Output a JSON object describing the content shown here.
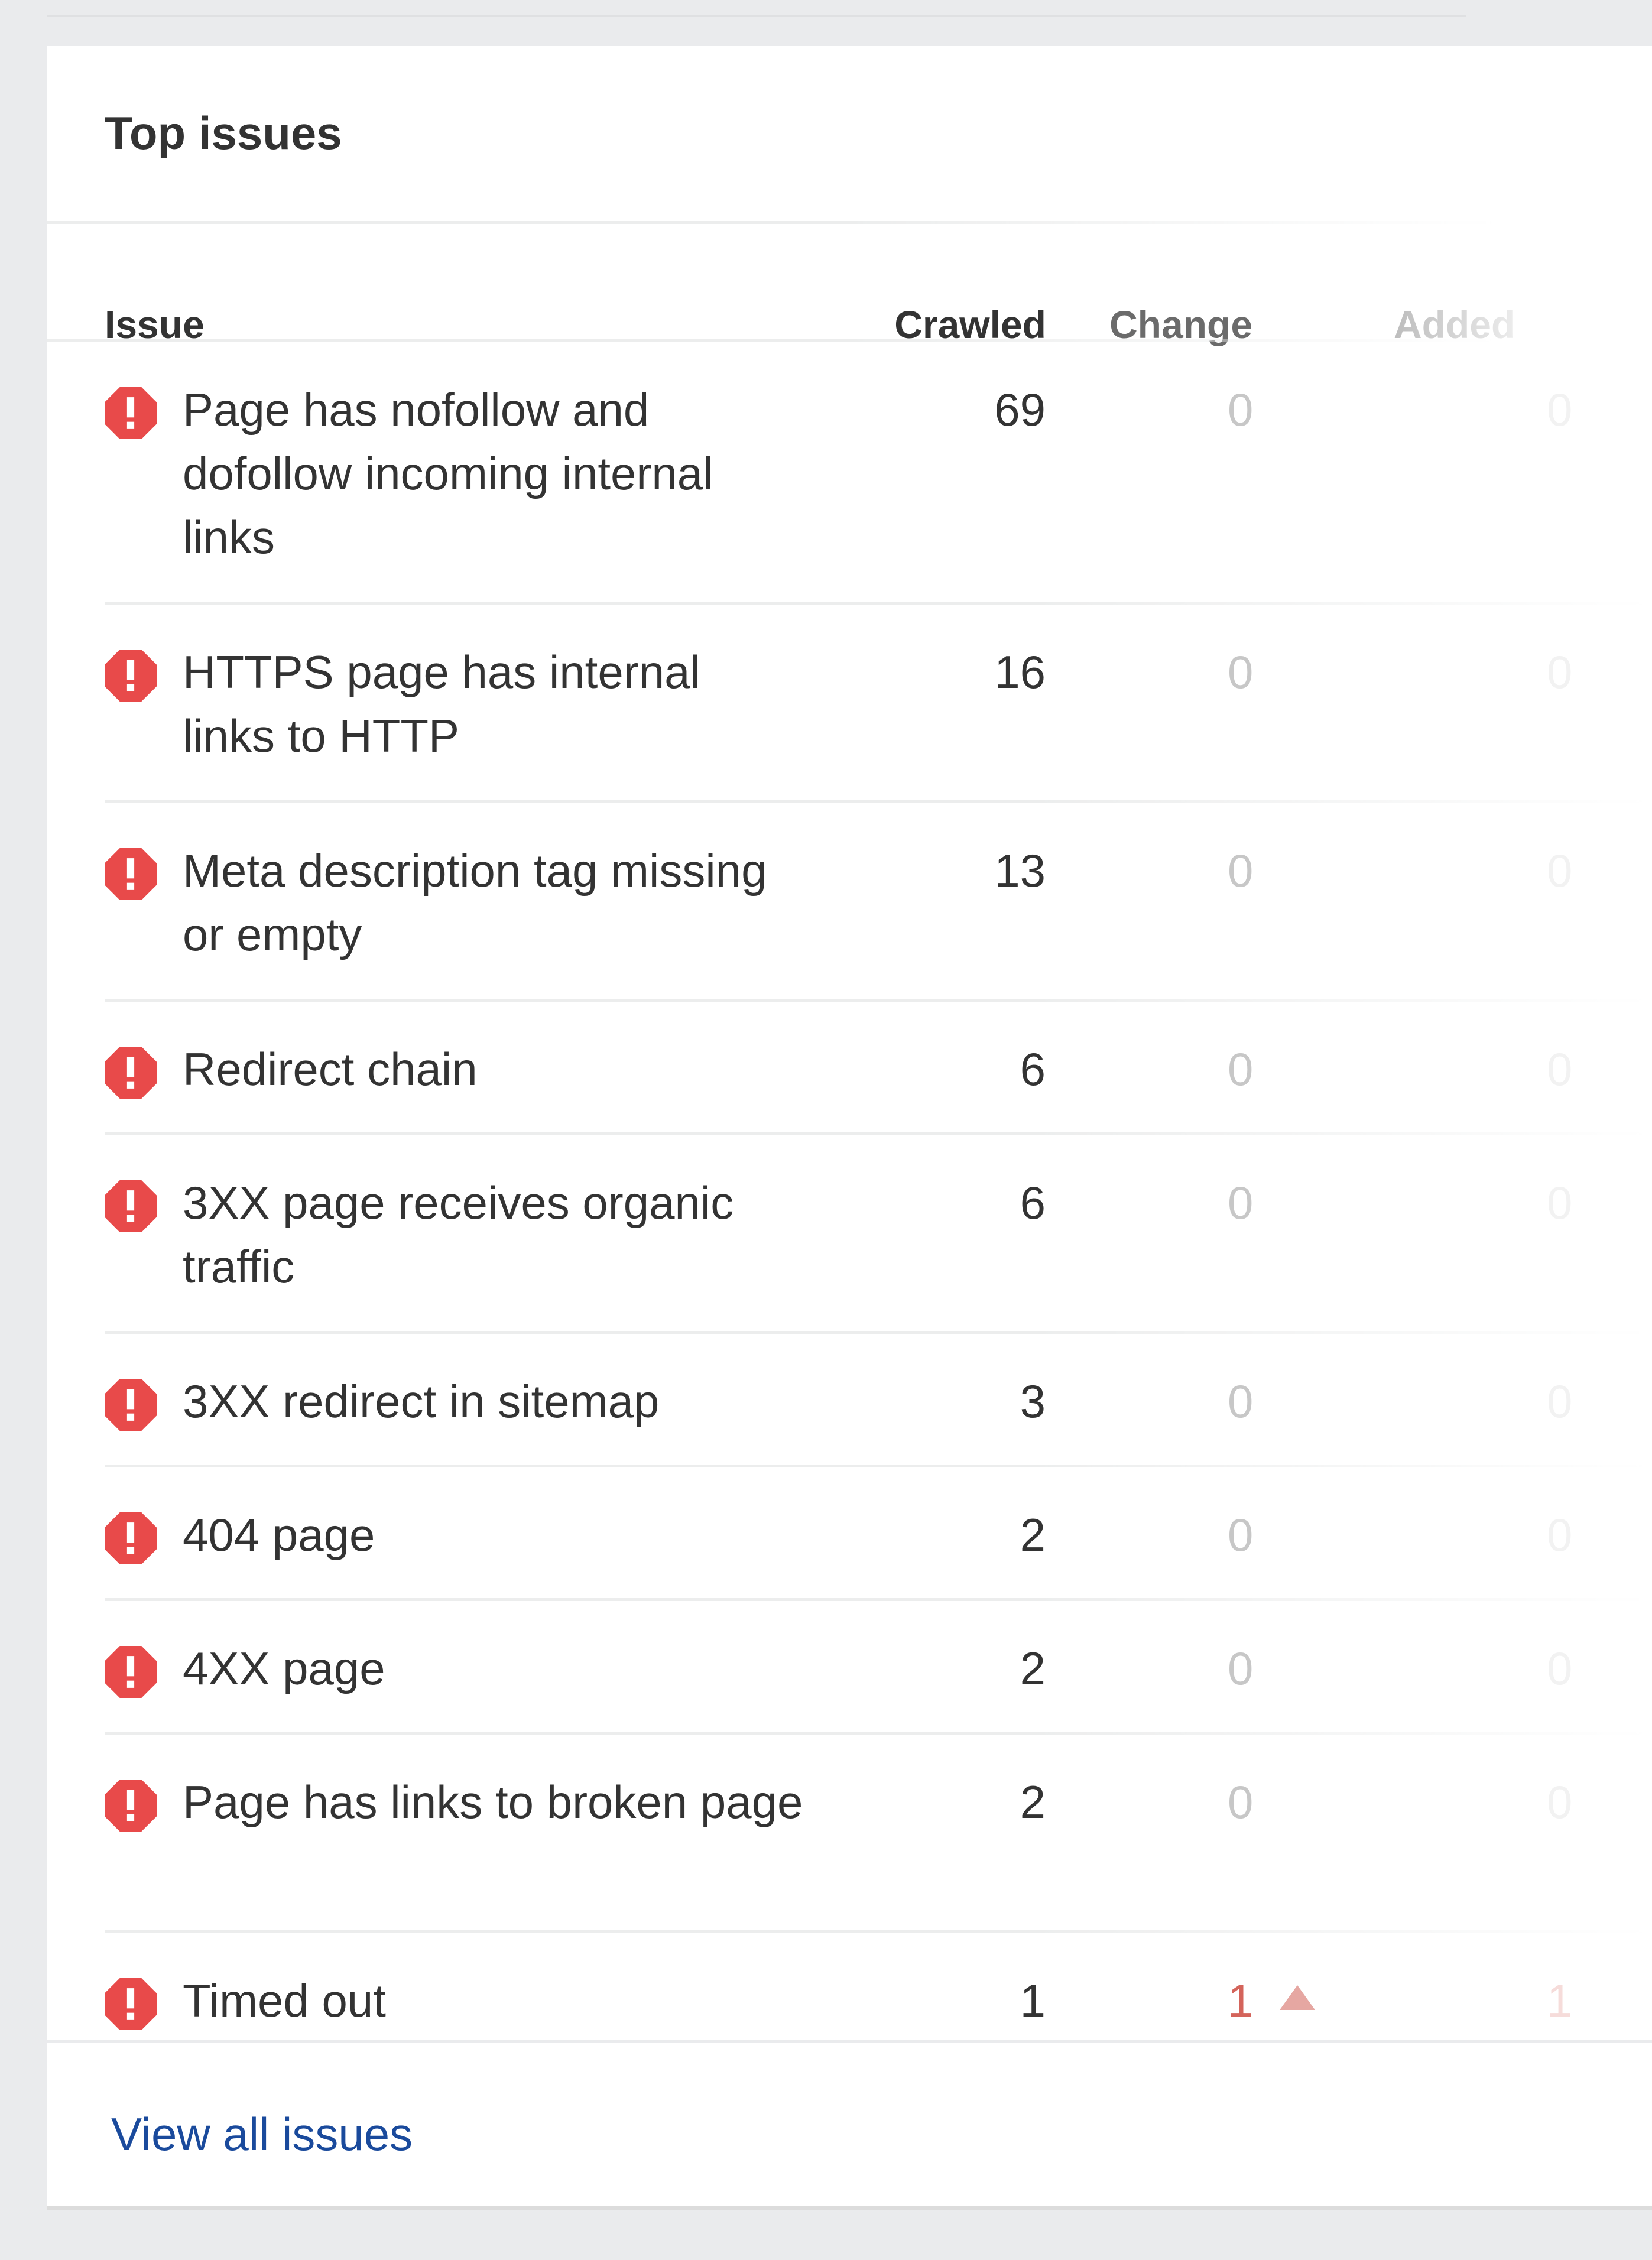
{
  "card": {
    "title": "Top issues",
    "footer_link": "View all issues"
  },
  "table": {
    "headers": {
      "issue": "Issue",
      "crawled": "Crawled",
      "change": "Change",
      "added": "Added"
    },
    "rows": [
      {
        "issue": "Page has nofollow and dofollow incoming internal links",
        "crawled": "69",
        "change": "0",
        "added": "0",
        "trend": "none"
      },
      {
        "issue": "HTTPS page has internal links to HTTP",
        "crawled": "16",
        "change": "0",
        "added": "0",
        "trend": "none"
      },
      {
        "issue": "Meta description tag missing or empty",
        "crawled": "13",
        "change": "0",
        "added": "0",
        "trend": "none"
      },
      {
        "issue": "Redirect chain",
        "crawled": "6",
        "change": "0",
        "added": "0",
        "trend": "none"
      },
      {
        "issue": "3XX page receives organic traffic",
        "crawled": "6",
        "change": "0",
        "added": "0",
        "trend": "none"
      },
      {
        "issue": "3XX redirect in sitemap",
        "crawled": "3",
        "change": "0",
        "added": "0",
        "trend": "none"
      },
      {
        "issue": "404 page",
        "crawled": "2",
        "change": "0",
        "added": "0",
        "trend": "none"
      },
      {
        "issue": "4XX page",
        "crawled": "2",
        "change": "0",
        "added": "0",
        "trend": "none"
      },
      {
        "issue": "Page has links to broken page",
        "crawled": "2",
        "change": "0",
        "added": "0",
        "trend": "none"
      },
      {
        "issue": "Timed out",
        "crawled": "1",
        "change": "1",
        "added": "1",
        "trend": "up"
      }
    ],
    "row_icon": "error-octagon-icon"
  },
  "colors": {
    "error": "#e84a4a",
    "link": "#1a4a9c",
    "increase": "#d4645b"
  }
}
